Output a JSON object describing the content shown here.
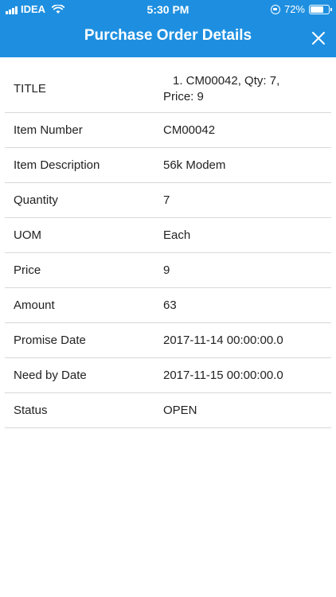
{
  "status_bar": {
    "carrier": "IDEA",
    "time": "5:30 PM",
    "battery": "72%",
    "battery_level": 0.72
  },
  "header": {
    "title": "Purchase Order Details",
    "close_icon": "close-icon"
  },
  "details": {
    "title_label": "TITLE",
    "title_value_line1": "1.  CM00042, Qty:  7,",
    "title_value_line2": "Price:  9",
    "rows": [
      {
        "label": "Item Number",
        "value": "CM00042"
      },
      {
        "label": "Item Description",
        "value": "56k Modem"
      },
      {
        "label": "Quantity",
        "value": "7"
      },
      {
        "label": "UOM",
        "value": "Each"
      },
      {
        "label": "Price",
        "value": "9"
      },
      {
        "label": "Amount",
        "value": "63"
      },
      {
        "label": "Promise Date",
        "value": "2017-11-14 00:00:00.0"
      },
      {
        "label": "Need by Date",
        "value": "2017-11-15 00:00:00.0"
      },
      {
        "label": "Status",
        "value": "OPEN"
      }
    ]
  }
}
